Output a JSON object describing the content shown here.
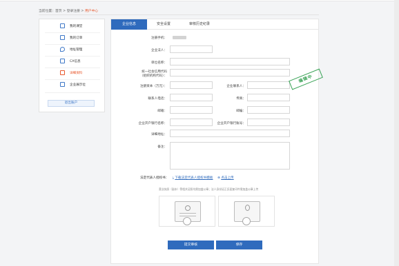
{
  "breadcrumb": {
    "prefix": "当前位置：",
    "home": "首页",
    "sep1": " > ",
    "login": "登录注册",
    "sep2": " > ",
    "current": "用户中心"
  },
  "sidebar": {
    "items": [
      {
        "label": "我的课堂",
        "icon": "book-icon"
      },
      {
        "label": "我的订单",
        "icon": "calendar-icon"
      },
      {
        "label": "地址管理",
        "icon": "location-icon"
      },
      {
        "label": "CA信息",
        "icon": "certificate-icon"
      },
      {
        "label": "详细资料",
        "icon": "profile-icon"
      },
      {
        "label": "企业展示位",
        "icon": "display-icon"
      }
    ],
    "active_index": 4,
    "logout_label": "退出账户"
  },
  "tabs": [
    {
      "label": "企业信息"
    },
    {
      "label": "安全设置"
    },
    {
      "label": "审核历史纪录"
    }
  ],
  "form": {
    "phone_label": "注册手机：",
    "legal_person_label": "企业法人：",
    "company_name_label": "单位名称：",
    "credit_code_label_1": "统一社会信用代码",
    "credit_code_label_2": "（组织机构代码）：",
    "capital_label": "注册资本（万元）：",
    "contact_label": "企业联系人：",
    "phone2_label": "联系人电话：",
    "fax_label": "传真：",
    "email_label": "邮箱：",
    "postcode_label": "邮编：",
    "bank_label": "企业开户银行名称：",
    "bank_account_label": "企业开户银行账号：",
    "address_label": "详细地址：",
    "remark_label": "备注："
  },
  "stamp_text": "编辑中",
  "auth": {
    "label": "法定代表人授权书：",
    "download_link": "下载法定代表人授权书模板",
    "upload_link": "点击上传"
  },
  "note": "营业执照（副本）等相关证照均需加盖公章；法人身份证正反面复印件需加盖公章上传",
  "buttons": {
    "submit": "提交审核",
    "save": "保存"
  },
  "colors": {
    "accent": "#2f6bbd",
    "active_orange": "#e8572b",
    "stamp_green": "#3aa356"
  }
}
